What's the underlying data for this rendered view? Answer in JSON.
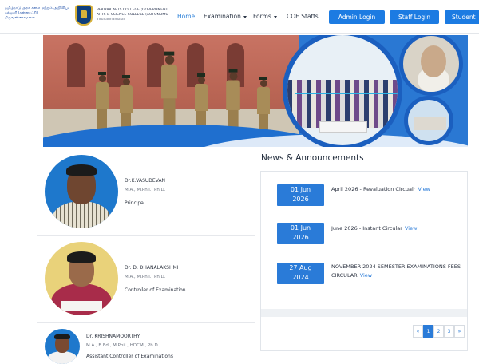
{
  "header": {
    "logo_left_lines": [
      "தமிழ்நாடு அரசு கலை மற்றும் அறிவியல்",
      "கல்லூரி (தன்னாட்சி)",
      "திருவண்ணாமலை"
    ],
    "college_lines": [
      "PERIYAR ARTS COLLEGE (GOVERNMENT)",
      "ARTS & SCIENCE COLLEGE (AUTONOMOUS)",
      "Tiruvannamalai"
    ],
    "nav": {
      "home": "Home",
      "examination": "Examination",
      "forms": "Forms",
      "coe_staffs": "COE Staffs"
    },
    "buttons": {
      "admin_login": "Admin Login",
      "staff_login": "Staff Login",
      "student_login": "Student"
    }
  },
  "profiles": [
    {
      "name": "Dr.K.VASUDEVAN",
      "degree": "M.A., M.Phil., Ph.D.",
      "role": "Principal"
    },
    {
      "name": "Dr. D. DHANALAKSHMI",
      "degree": "M.A., M.Phil., Ph.D.",
      "role": "Controller of Examination"
    },
    {
      "name": "Dr. KRISHNAMOORTHY",
      "degree": "M.A., B.Ed., M.Phil., HDCM., Ph.D.,",
      "role": "Assistant Controller of Examinations"
    }
  ],
  "news": {
    "title": "News & Announcements",
    "items": [
      {
        "date_day": "01 Jun",
        "date_year": "2026",
        "text": "April 2026 - Revaluation Circualr",
        "view": "View"
      },
      {
        "date_day": "01 Jun",
        "date_year": "2026",
        "text": "June 2026 - Instant Circular",
        "view": "View"
      },
      {
        "date_day": "27 Aug",
        "date_year": "2024",
        "text": "NOVEMBER 2024 SEMESTER EXAMINATIONS FEES CIRCULAR",
        "view": "View"
      }
    ],
    "pagination": [
      "«",
      "1",
      "2",
      "3",
      "»"
    ]
  }
}
